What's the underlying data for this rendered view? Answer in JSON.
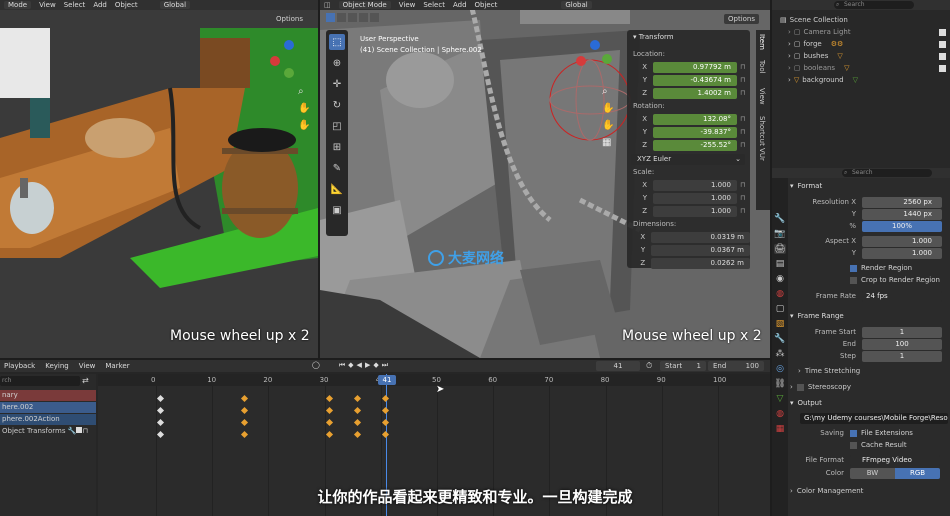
{
  "left_viewport": {
    "header": {
      "mode": "Mode",
      "menus": [
        "View",
        "Select",
        "Add",
        "Object"
      ],
      "transform": "Global",
      "options": "Options"
    },
    "caption": "Mouse wheel up x 2"
  },
  "main_viewport": {
    "header": {
      "mode": "Object Mode",
      "menus": [
        "View",
        "Select",
        "Add",
        "Object"
      ],
      "transform": "Global",
      "options": "Options"
    },
    "info_line1": "User Perspective",
    "info_line2": "(41) Scene Collection | Sphere.002",
    "caption": "Mouse wheel up x 2",
    "watermark": "大麦网络",
    "side_tabs": [
      "Item",
      "Tool",
      "View",
      "Shortcut VUr"
    ]
  },
  "transform_panel": {
    "title": "Transform",
    "location_label": "Location:",
    "location": [
      {
        "axis": "X",
        "value": "0.97792 m"
      },
      {
        "axis": "Y",
        "value": "-0.43674 m"
      },
      {
        "axis": "Z",
        "value": "1.4002 m"
      }
    ],
    "rotation_label": "Rotation:",
    "rotation": [
      {
        "axis": "X",
        "value": "132.08°"
      },
      {
        "axis": "Y",
        "value": "-39.837°"
      },
      {
        "axis": "Z",
        "value": "-255.52°"
      }
    ],
    "rotation_mode": "XYZ Euler",
    "scale_label": "Scale:",
    "scale": [
      {
        "axis": "X",
        "value": "1.000"
      },
      {
        "axis": "Y",
        "value": "1.000"
      },
      {
        "axis": "Z",
        "value": "1.000"
      }
    ],
    "dimensions_label": "Dimensions:",
    "dimensions": [
      {
        "axis": "X",
        "value": "0.0319 m"
      },
      {
        "axis": "Y",
        "value": "0.0367 m"
      },
      {
        "axis": "Z",
        "value": "0.0262 m"
      }
    ]
  },
  "outliner": {
    "search_placeholder": "Search",
    "root": "Scene Collection",
    "items": [
      "Camera Light",
      "forge",
      "bushes",
      "booleans",
      "background"
    ]
  },
  "properties": {
    "search_placeholder": "Search",
    "format_title": "Format",
    "resolution_x_label": "Resolution X",
    "resolution_x": "2560 px",
    "resolution_y_label": "Y",
    "resolution_y": "1440 px",
    "percent_label": "%",
    "percent": "100%",
    "aspect_x_label": "Aspect X",
    "aspect_x": "1.000",
    "aspect_y_label": "Y",
    "aspect_y": "1.000",
    "render_region": "Render Region",
    "crop_region": "Crop to Render Region",
    "frame_rate_label": "Frame Rate",
    "frame_rate": "24 fps",
    "frame_range_title": "Frame Range",
    "frame_start_label": "Frame Start",
    "frame_start": "1",
    "end_label": "End",
    "end": "100",
    "step_label": "Step",
    "step": "1",
    "time_stretching": "Time Stretching",
    "stereoscopy": "Stereoscopy",
    "output_title": "Output",
    "output_path": "G:\\my Udemy courses\\Mobile Forge\\Reso...",
    "saving_label": "Saving",
    "file_extensions": "File Extensions",
    "cache_result": "Cache Result",
    "file_format_label": "File Format",
    "file_format": "FFmpeg Video",
    "color_label": "Color",
    "color_bw": "BW",
    "color_rgb": "RGB",
    "color_management": "Color Management"
  },
  "timeline": {
    "menus": [
      "Playback",
      "Keying",
      "View",
      "Marker"
    ],
    "current_frame": "41",
    "start_label": "Start",
    "start": "1",
    "end_label": "End",
    "end": "100",
    "ticks": [
      "0",
      "10",
      "20",
      "30",
      "40",
      "50",
      "60",
      "70",
      "80",
      "90",
      "100"
    ],
    "tracks": [
      "nary",
      "here.002",
      "phere.002Action",
      "Object Transforms"
    ],
    "search_placeholder": "rch"
  },
  "subtitle": "让你的作品看起来更精致和专业。一旦构建完成",
  "colors": {
    "accent": "#4772b3",
    "field_green": "#5a8a3a",
    "keyframe": "#e8a030"
  }
}
